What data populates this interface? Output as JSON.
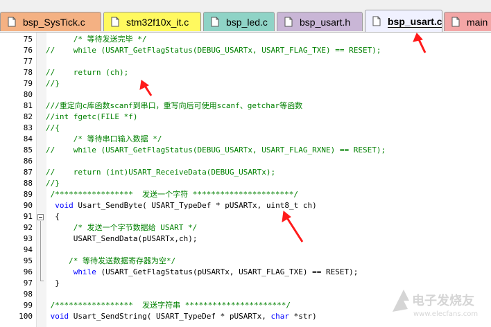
{
  "tabs": [
    {
      "label": "bsp_SysTick.c",
      "bg": "#f4b183",
      "active": false
    },
    {
      "label": "stm32f10x_it.c",
      "bg": "#fff95f",
      "active": false
    },
    {
      "label": "bsp_led.c",
      "bg": "#8fd3c6",
      "active": false
    },
    {
      "label": "bsp_usart.h",
      "bg": "#c9b6d6",
      "active": false
    },
    {
      "label": "bsp_usart.c",
      "bg": "#f0f1ff",
      "active": true
    },
    {
      "label": "main",
      "bg": "#f3a6a6",
      "active": false
    }
  ],
  "colors": {
    "comment": "#008000",
    "keyword": "#0000ff",
    "arrow": "#ff1a1a"
  },
  "icons": {
    "file": "file-icon",
    "fold": "fold-minus-icon"
  },
  "lines": [
    {
      "n": "75",
      "segs": [
        {
          "t": "      /* 等待发送完毕 */",
          "c": "c"
        }
      ]
    },
    {
      "n": "76",
      "segs": [
        {
          "t": "//    while (USART_GetFlagStatus(DEBUG_USARTx, USART_FLAG_TXE) == RESET);",
          "c": "c"
        }
      ]
    },
    {
      "n": "77",
      "segs": []
    },
    {
      "n": "78",
      "segs": [
        {
          "t": "//    return (ch);",
          "c": "c"
        }
      ]
    },
    {
      "n": "79",
      "segs": [
        {
          "t": "//}",
          "c": "c"
        }
      ]
    },
    {
      "n": "80",
      "segs": []
    },
    {
      "n": "81",
      "segs": [
        {
          "t": "///重定向c库函数scanf到串口，重写向后可使用scanf、getchar等函数",
          "c": "c"
        }
      ]
    },
    {
      "n": "82",
      "segs": [
        {
          "t": "//int fgetc(FILE *f)",
          "c": "c"
        }
      ]
    },
    {
      "n": "83",
      "segs": [
        {
          "t": "//{",
          "c": "c"
        }
      ]
    },
    {
      "n": "84",
      "segs": [
        {
          "t": "      /* 等待串口输入数据 */",
          "c": "c"
        }
      ]
    },
    {
      "n": "85",
      "segs": [
        {
          "t": "//    while (USART_GetFlagStatus(DEBUG_USARTx, USART_FLAG_RXNE) == RESET);",
          "c": "c"
        }
      ]
    },
    {
      "n": "86",
      "segs": []
    },
    {
      "n": "87",
      "segs": [
        {
          "t": "//    return (int)USART_ReceiveData(DEBUG_USARTx);",
          "c": "c"
        }
      ]
    },
    {
      "n": "88",
      "segs": [
        {
          "t": "//}",
          "c": "c"
        }
      ]
    },
    {
      "n": "89",
      "segs": [
        {
          "t": " /*****************  发送一个字符 **********************/",
          "c": "c"
        }
      ]
    },
    {
      "n": "90",
      "segs": [
        {
          "t": "  ",
          "c": ""
        },
        {
          "t": "void",
          "c": "k"
        },
        {
          "t": " Usart_SendByte( USART_TypeDef * pUSARTx, uint8_t ch)",
          "c": ""
        }
      ]
    },
    {
      "n": "91",
      "segs": [
        {
          "t": "  {",
          "c": ""
        }
      ]
    },
    {
      "n": "92",
      "segs": [
        {
          "t": "      /* 发送一个字节数据给 USART */",
          "c": "c"
        }
      ]
    },
    {
      "n": "93",
      "segs": [
        {
          "t": "      USART_SendData(pUSARTx,ch);",
          "c": ""
        }
      ]
    },
    {
      "n": "94",
      "segs": []
    },
    {
      "n": "95",
      "segs": [
        {
          "t": "     /* 等待发送数据寄存器为空*/",
          "c": "c"
        }
      ]
    },
    {
      "n": "96",
      "segs": [
        {
          "t": "      ",
          "c": ""
        },
        {
          "t": "while",
          "c": "k"
        },
        {
          "t": " (USART_GetFlagStatus(pUSARTx, USART_FLAG_TXE) == RESET);",
          "c": ""
        }
      ]
    },
    {
      "n": "97",
      "segs": [
        {
          "t": "  }",
          "c": ""
        }
      ]
    },
    {
      "n": "98",
      "segs": []
    },
    {
      "n": "99",
      "segs": [
        {
          "t": " /*****************  发送字符串 **********************/",
          "c": "c"
        }
      ]
    },
    {
      "n": "100",
      "segs": [
        {
          "t": " ",
          "c": ""
        },
        {
          "t": "void",
          "c": "k"
        },
        {
          "t": " Usart_SendString( USART_TypeDef * pUSARTx, ",
          "c": ""
        },
        {
          "t": "char",
          "c": "k"
        },
        {
          "t": " *str)",
          "c": ""
        }
      ]
    }
  ],
  "watermark": {
    "line1": "电子发烧友",
    "line2": "www.elecfans.com"
  }
}
